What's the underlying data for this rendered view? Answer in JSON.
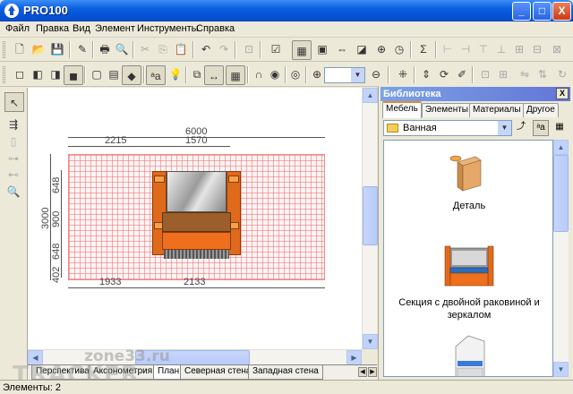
{
  "window": {
    "title": "PRO100",
    "minimize": "_",
    "maximize": "□",
    "close": "X"
  },
  "menu": [
    "Файл",
    "Правка",
    "Вид",
    "Элемент",
    "Инструменты",
    "Справка"
  ],
  "zoom": {
    "value": ""
  },
  "plan": {
    "width_total": "6000",
    "width_left": "2215",
    "width_right": "1570",
    "height_total": "3000",
    "height_a": "648",
    "height_b": "900",
    "height_c": "648",
    "height_d": "402",
    "bottom_left": "1933",
    "bottom_right": "2133"
  },
  "view_tabs": [
    "Перспектива",
    "Аксонометрия",
    "План",
    "Северная стена",
    "Западная стена"
  ],
  "library": {
    "title": "Библиотека",
    "close": "X",
    "tabs": [
      "Мебель",
      "Элементы",
      "Материалы",
      "Другое"
    ],
    "folder": "Ванная",
    "items": [
      {
        "label": "Деталь"
      },
      {
        "label": "Секция с двойной раковиной и зеркалом"
      }
    ]
  },
  "status": {
    "text": "Элементы: 2"
  },
  "watermark": {
    "site": "zone33.ru",
    "brand": "TRACKER"
  }
}
